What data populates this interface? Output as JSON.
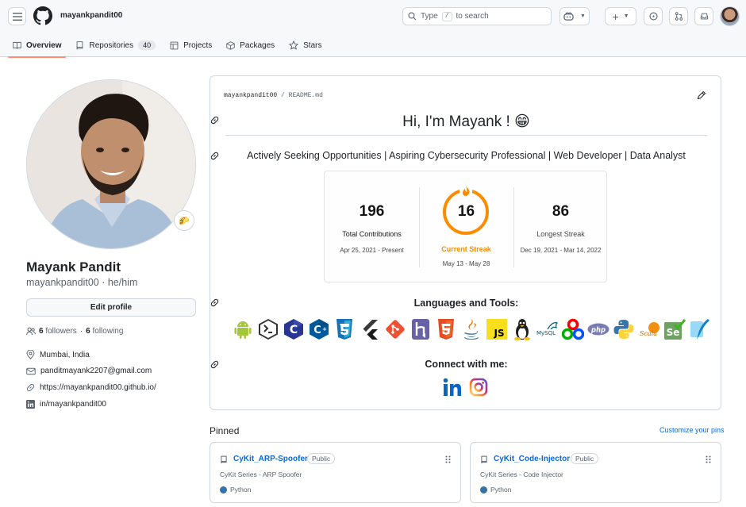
{
  "header": {
    "username": "mayankpandit00",
    "search_prefix": "Type",
    "search_key": "/",
    "search_suffix": "to search"
  },
  "tabs": [
    {
      "label": "Overview",
      "icon": "book-icon",
      "selected": true
    },
    {
      "label": "Repositories",
      "icon": "repo-icon",
      "count": "40"
    },
    {
      "label": "Projects",
      "icon": "table-icon"
    },
    {
      "label": "Packages",
      "icon": "package-icon"
    },
    {
      "label": "Stars",
      "icon": "star-icon"
    }
  ],
  "profile": {
    "name": "Mayank Pandit",
    "handle": "mayankpandit00 · he/him",
    "edit_label": "Edit profile",
    "followers_count": "6",
    "followers_label": "followers",
    "dot": "·",
    "following_count": "6",
    "following_label": "following",
    "location": "Mumbai, India",
    "email": "panditmayank2207@gmail.com",
    "website": "https://mayankpandit00.github.io/",
    "linkedin": "in/mayankpandit00",
    "status_emoji": "🌮"
  },
  "readme": {
    "path_user": "mayankpandit00",
    "path_sep": "/",
    "path_file": "README.md",
    "greeting": "Hi, I'm Mayank ! 😁",
    "tagline": "Actively Seeking Opportunities | Aspiring Cybersecurity Professional | Web Developer | Data Analyst",
    "streak": {
      "total": "196",
      "total_label": "Total Contributions",
      "total_range": "Apr 25, 2021 - Present",
      "current": "16",
      "current_label": "Current Streak",
      "current_range": "May 13 - May 28",
      "longest": "86",
      "longest_label": "Longest Streak",
      "longest_range": "Dec 19, 2021 - Mar 14, 2022",
      "accent": "#fb8c00"
    },
    "languages_title": "Languages and Tools:",
    "languages": [
      "android",
      "bash",
      "c",
      "cplusplus",
      "css3",
      "flutter",
      "git",
      "heroku",
      "html5",
      "java",
      "javascript",
      "linux",
      "mysql",
      "opencv",
      "php",
      "python",
      "scala",
      "selenium",
      "sqlite"
    ],
    "connect_title": "Connect with me:",
    "socials": [
      "linkedin",
      "instagram"
    ]
  },
  "pinned": {
    "title": "Pinned",
    "customize": "Customize your pins",
    "items": [
      {
        "name": "CyKit_ARP-Spoofer",
        "badge": "Public",
        "desc": "CyKit Series - ARP Spoofer",
        "lang": "Python",
        "lang_color": "#3572A5"
      },
      {
        "name": "CyKit_Code-Injector",
        "badge": "Public",
        "desc": "CyKit Series - Code Injector",
        "lang": "Python",
        "lang_color": "#3572A5"
      }
    ]
  },
  "colors": {
    "link": "#0969da",
    "tab_underline": "#fd8c73",
    "python": "#3572A5"
  }
}
